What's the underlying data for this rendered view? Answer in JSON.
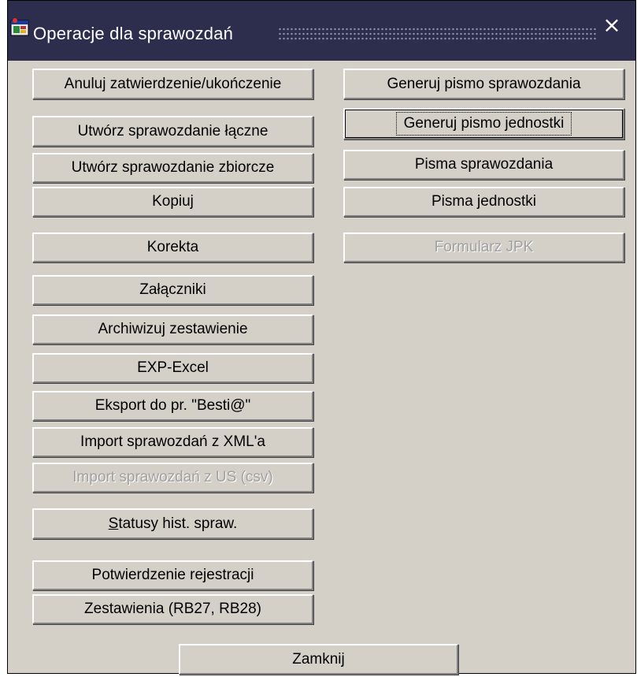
{
  "window": {
    "title": "Operacje dla sprawozdań",
    "close_symbol": "×",
    "icon": "app-window-icon"
  },
  "left_buttons": [
    {
      "label": "Anuluj zatwierdzenie/ukończenie",
      "enabled": true
    },
    {
      "label": "Utwórz sprawozdanie łączne",
      "enabled": true
    },
    {
      "label": "Utwórz sprawozdanie zbiorcze",
      "enabled": true
    },
    {
      "label": "Kopiuj",
      "enabled": true
    },
    {
      "label": "Korekta",
      "enabled": true
    },
    {
      "label": "Załączniki",
      "enabled": true
    },
    {
      "label": "Archiwizuj zestawienie",
      "enabled": true
    },
    {
      "label": "EXP-Excel",
      "enabled": true
    },
    {
      "label": "Eksport do pr. \"Besti@\"",
      "enabled": true
    },
    {
      "label": "Import sprawozdań z XML'a",
      "enabled": true
    },
    {
      "label": "Import sprawozdań z US (csv)",
      "enabled": false
    },
    {
      "label_first": "S",
      "label_rest": "tatusy hist. spraw.",
      "enabled": true
    },
    {
      "label": "Potwierdzenie rejestracji",
      "enabled": true
    },
    {
      "label": "Zestawienia (RB27, RB28)",
      "enabled": true
    }
  ],
  "right_buttons": [
    {
      "label": "Generuj pismo sprawozdania",
      "enabled": true
    },
    {
      "label": "Generuj pismo jednostki",
      "enabled": true,
      "focused": true
    },
    {
      "label": "Pisma sprawozdania",
      "enabled": true
    },
    {
      "label": "Pisma jednostki",
      "enabled": true
    },
    {
      "label": "Formularz JPK",
      "enabled": false
    }
  ],
  "footer": {
    "close_label": "Zamknij"
  }
}
